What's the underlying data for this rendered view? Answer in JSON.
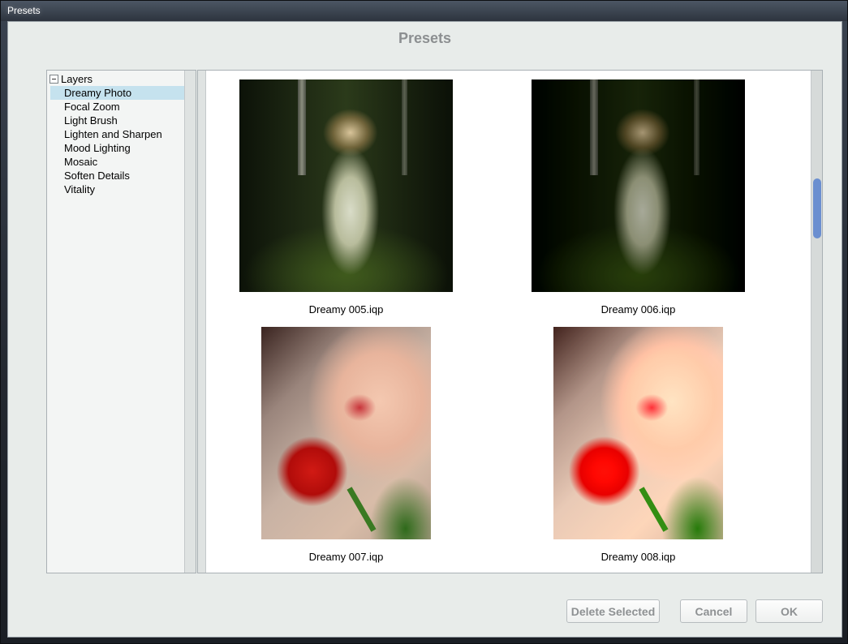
{
  "window": {
    "title": "Presets"
  },
  "dialog": {
    "title": "Presets"
  },
  "tree": {
    "root_label": "Layers",
    "items": [
      {
        "label": "Dreamy Photo",
        "selected": true
      },
      {
        "label": "Focal Zoom",
        "selected": false
      },
      {
        "label": "Light Brush",
        "selected": false
      },
      {
        "label": "Lighten and Sharpen",
        "selected": false
      },
      {
        "label": "Mood Lighting",
        "selected": false
      },
      {
        "label": "Mosaic",
        "selected": false
      },
      {
        "label": "Soften Details",
        "selected": false
      },
      {
        "label": "Vitality",
        "selected": false
      }
    ]
  },
  "presets": [
    {
      "name": "Dreamy 005.iqp",
      "image": "forest-dancer"
    },
    {
      "name": "Dreamy 006.iqp",
      "image": "forest-dancer-darker"
    },
    {
      "name": "Dreamy 007.iqp",
      "image": "rose-lips"
    },
    {
      "name": "Dreamy 008.iqp",
      "image": "rose-lips-brighter"
    }
  ],
  "buttons": {
    "delete_selected": "Delete Selected",
    "cancel": "Cancel",
    "ok": "OK"
  },
  "colors": {
    "selection": "#c5e2ee",
    "scroll_thumb": "#6b8fd0",
    "dialog_background": "#e8ecea"
  }
}
